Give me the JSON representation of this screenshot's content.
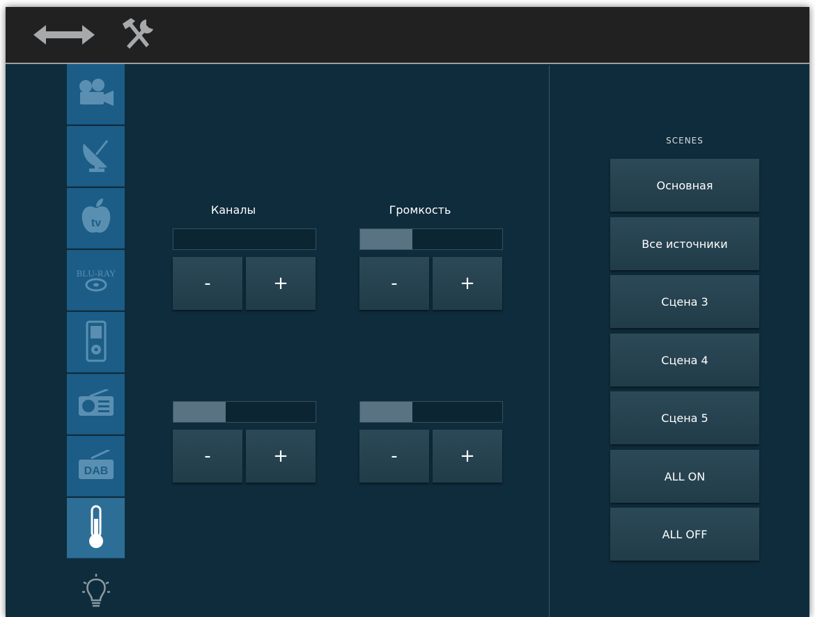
{
  "topbar": {
    "icons": [
      "double-arrow-icon",
      "tools-icon"
    ]
  },
  "sidebar": {
    "items": [
      {
        "icon": "film-camera-icon",
        "active": false
      },
      {
        "icon": "satellite-dish-icon",
        "active": false
      },
      {
        "icon": "apple-tv-icon",
        "active": false,
        "label": "tv"
      },
      {
        "icon": "blu-ray-icon",
        "active": false,
        "label": "BLU-RAY"
      },
      {
        "icon": "ipod-icon",
        "active": false
      },
      {
        "icon": "radio-icon",
        "active": false
      },
      {
        "icon": "dab-radio-icon",
        "active": false,
        "label": "DAB"
      },
      {
        "icon": "thermometer-icon",
        "active": true
      }
    ],
    "bottom_icon": "light-bulb-icon"
  },
  "controls": {
    "channels": {
      "label": "Каналы",
      "level": 0.0
    },
    "volume": {
      "label": "Громкость",
      "level": 0.37
    },
    "control3": {
      "level": 0.37
    },
    "control4": {
      "level": 0.37
    },
    "minus_label": "-",
    "plus_label": "+"
  },
  "scenes": {
    "title": "SCENES",
    "buttons": [
      "Основная",
      "Все источники",
      "Сцена 3",
      "Сцена 4",
      "Сцена 5",
      "ALL ON",
      "ALL OFF"
    ]
  },
  "colors": {
    "background": "#0f2c3c",
    "topbar": "#212121",
    "sidebar": "#1b5d86",
    "button": "#2c4957",
    "bar_fill": "#5a7383"
  }
}
